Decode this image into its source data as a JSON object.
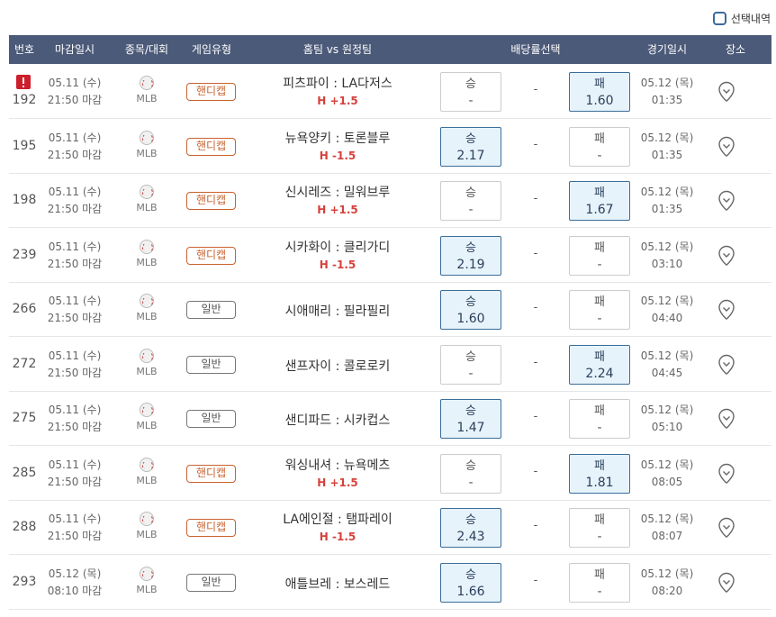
{
  "top": {
    "select_history_label": "선택내역"
  },
  "header": {
    "no": "번호",
    "deadline": "마감일시",
    "league": "종목/대회",
    "game_type": "게임유형",
    "teams": "홈팀 vs 원정팀",
    "odds_select": "배당률선택",
    "game_time": "경기일시",
    "venue": "장소"
  },
  "rows": [
    {
      "no": "192",
      "alert": true,
      "dl_date": "05.11 (수)",
      "dl_time": "21:50 마감",
      "league": "MLB",
      "type": "핸디캡",
      "type_kind": "hc",
      "teams": "피츠파이 : LA다저스",
      "handicap": "H +1.5",
      "win_label": "승",
      "win_val": "-",
      "win_on": false,
      "draw": "-",
      "lose_label": "패",
      "lose_val": "1.60",
      "lose_on": true,
      "gt_date": "05.12 (목)",
      "gt_time": "01:35"
    },
    {
      "no": "195",
      "alert": false,
      "dl_date": "05.11 (수)",
      "dl_time": "21:50 마감",
      "league": "MLB",
      "type": "핸디캡",
      "type_kind": "hc",
      "teams": "뉴욕양키 : 토론블루",
      "handicap": "H -1.5",
      "win_label": "승",
      "win_val": "2.17",
      "win_on": true,
      "draw": "-",
      "lose_label": "패",
      "lose_val": "-",
      "lose_on": false,
      "gt_date": "05.12 (목)",
      "gt_time": "01:35"
    },
    {
      "no": "198",
      "alert": false,
      "dl_date": "05.11 (수)",
      "dl_time": "21:50 마감",
      "league": "MLB",
      "type": "핸디캡",
      "type_kind": "hc",
      "teams": "신시레즈 : 밀워브루",
      "handicap": "H +1.5",
      "win_label": "승",
      "win_val": "-",
      "win_on": false,
      "draw": "-",
      "lose_label": "패",
      "lose_val": "1.67",
      "lose_on": true,
      "gt_date": "05.12 (목)",
      "gt_time": "01:35"
    },
    {
      "no": "239",
      "alert": false,
      "dl_date": "05.11 (수)",
      "dl_time": "21:50 마감",
      "league": "MLB",
      "type": "핸디캡",
      "type_kind": "hc",
      "teams": "시카화이 : 클리가디",
      "handicap": "H -1.5",
      "win_label": "승",
      "win_val": "2.19",
      "win_on": true,
      "draw": "-",
      "lose_label": "패",
      "lose_val": "-",
      "lose_on": false,
      "gt_date": "05.12 (목)",
      "gt_time": "03:10"
    },
    {
      "no": "266",
      "alert": false,
      "dl_date": "05.11 (수)",
      "dl_time": "21:50 마감",
      "league": "MLB",
      "type": "일반",
      "type_kind": "nm",
      "teams": "시애매리 : 필라필리",
      "handicap": "",
      "win_label": "승",
      "win_val": "1.60",
      "win_on": true,
      "draw": "-",
      "lose_label": "패",
      "lose_val": "-",
      "lose_on": false,
      "gt_date": "05.12 (목)",
      "gt_time": "04:40"
    },
    {
      "no": "272",
      "alert": false,
      "dl_date": "05.11 (수)",
      "dl_time": "21:50 마감",
      "league": "MLB",
      "type": "일반",
      "type_kind": "nm",
      "teams": "샌프자이 : 콜로로키",
      "handicap": "",
      "win_label": "승",
      "win_val": "-",
      "win_on": false,
      "draw": "-",
      "lose_label": "패",
      "lose_val": "2.24",
      "lose_on": true,
      "gt_date": "05.12 (목)",
      "gt_time": "04:45"
    },
    {
      "no": "275",
      "alert": false,
      "dl_date": "05.11 (수)",
      "dl_time": "21:50 마감",
      "league": "MLB",
      "type": "일반",
      "type_kind": "nm",
      "teams": "샌디파드 : 시카컵스",
      "handicap": "",
      "win_label": "승",
      "win_val": "1.47",
      "win_on": true,
      "draw": "-",
      "lose_label": "패",
      "lose_val": "-",
      "lose_on": false,
      "gt_date": "05.12 (목)",
      "gt_time": "05:10"
    },
    {
      "no": "285",
      "alert": false,
      "dl_date": "05.11 (수)",
      "dl_time": "21:50 마감",
      "league": "MLB",
      "type": "핸디캡",
      "type_kind": "hc",
      "teams": "워싱내셔 : 뉴욕메츠",
      "handicap": "H +1.5",
      "win_label": "승",
      "win_val": "-",
      "win_on": false,
      "draw": "-",
      "lose_label": "패",
      "lose_val": "1.81",
      "lose_on": true,
      "gt_date": "05.12 (목)",
      "gt_time": "08:05"
    },
    {
      "no": "288",
      "alert": false,
      "dl_date": "05.11 (수)",
      "dl_time": "21:50 마감",
      "league": "MLB",
      "type": "핸디캡",
      "type_kind": "hc",
      "teams": "LA에인절 : 탬파레이",
      "handicap": "H -1.5",
      "win_label": "승",
      "win_val": "2.43",
      "win_on": true,
      "draw": "-",
      "lose_label": "패",
      "lose_val": "-",
      "lose_on": false,
      "gt_date": "05.12 (목)",
      "gt_time": "08:07"
    },
    {
      "no": "293",
      "alert": false,
      "dl_date": "05.12 (목)",
      "dl_time": "08:10 마감",
      "league": "MLB",
      "type": "일반",
      "type_kind": "nm",
      "teams": "애틀브레 : 보스레드",
      "handicap": "",
      "win_label": "승",
      "win_val": "1.66",
      "win_on": true,
      "draw": "-",
      "lose_label": "패",
      "lose_val": "-",
      "lose_on": false,
      "gt_date": "05.12 (목)",
      "gt_time": "08:20"
    }
  ]
}
